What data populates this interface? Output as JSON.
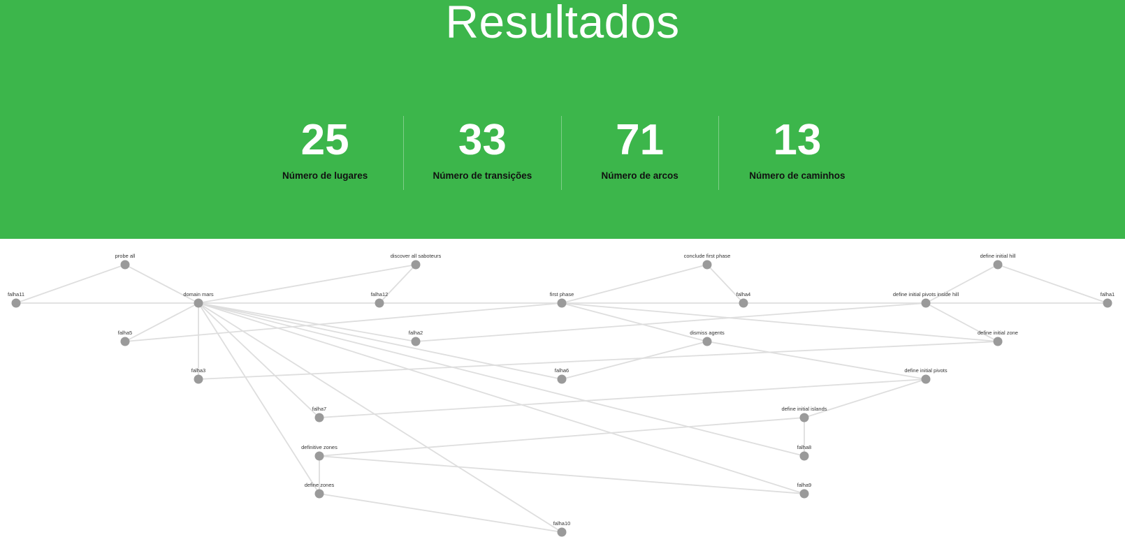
{
  "header": {
    "title": "Resultados"
  },
  "stats": [
    {
      "value": "25",
      "label": "Número de lugares"
    },
    {
      "value": "33",
      "label": "Número de transições"
    },
    {
      "value": "71",
      "label": "Número de arcos"
    },
    {
      "value": "13",
      "label": "Número de caminhos"
    }
  ],
  "colors": {
    "accent": "#3cb64b",
    "node": "#9a9a9a",
    "edge": "#dedede"
  },
  "graph": {
    "nodes": [
      {
        "id": "probe_all",
        "label": "probe all"
      },
      {
        "id": "discover_all_saboteurs",
        "label": "discover all saboteurs"
      },
      {
        "id": "conclude_first_phase",
        "label": "conclude first phase"
      },
      {
        "id": "define_initial_hill",
        "label": "define initial hill"
      },
      {
        "id": "falha11",
        "label": "falha11"
      },
      {
        "id": "domain_mars",
        "label": "domain mars"
      },
      {
        "id": "falha12",
        "label": "falha12"
      },
      {
        "id": "first_phase",
        "label": "first phase"
      },
      {
        "id": "falha4",
        "label": "falha4"
      },
      {
        "id": "define_initial_pivots_inside_hill",
        "label": "define initial pivots inside hill"
      },
      {
        "id": "falha1",
        "label": "falha1"
      },
      {
        "id": "falha5",
        "label": "falha5"
      },
      {
        "id": "falha2",
        "label": "falha2"
      },
      {
        "id": "dismiss_agents",
        "label": "dismiss agents"
      },
      {
        "id": "define_initial_zone",
        "label": "define initial zone"
      },
      {
        "id": "falha3",
        "label": "falha3"
      },
      {
        "id": "falha6",
        "label": "falha6"
      },
      {
        "id": "define_initial_pivots",
        "label": "define initial pivots"
      },
      {
        "id": "falha7",
        "label": "falha7"
      },
      {
        "id": "define_initial_islands",
        "label": "define initial islands"
      },
      {
        "id": "definitive_zones",
        "label": "definitive zones"
      },
      {
        "id": "falha8",
        "label": "falha8"
      },
      {
        "id": "define_zones",
        "label": "define zones"
      },
      {
        "id": "falha9",
        "label": "falha9"
      },
      {
        "id": "falha10",
        "label": "falha10"
      }
    ],
    "edges": [
      [
        "probe_all",
        "falha11"
      ],
      [
        "probe_all",
        "domain_mars"
      ],
      [
        "falha11",
        "domain_mars"
      ],
      [
        "discover_all_saboteurs",
        "domain_mars"
      ],
      [
        "discover_all_saboteurs",
        "falha12"
      ],
      [
        "domain_mars",
        "first_phase"
      ],
      [
        "domain_mars",
        "falha5"
      ],
      [
        "falha3",
        "domain_mars"
      ],
      [
        "domain_mars",
        "falha2"
      ],
      [
        "domain_mars",
        "falha6"
      ],
      [
        "domain_mars",
        "falha7"
      ],
      [
        "domain_mars",
        "define_zones"
      ],
      [
        "domain_mars",
        "falha8"
      ],
      [
        "domain_mars",
        "falha9"
      ],
      [
        "domain_mars",
        "falha10"
      ],
      [
        "first_phase",
        "falha5"
      ],
      [
        "first_phase",
        "conclude_first_phase"
      ],
      [
        "first_phase",
        "falha4"
      ],
      [
        "conclude_first_phase",
        "falha4"
      ],
      [
        "first_phase",
        "dismiss_agents"
      ],
      [
        "first_phase",
        "define_initial_zone"
      ],
      [
        "dismiss_agents",
        "falha6"
      ],
      [
        "dismiss_agents",
        "define_initial_pivots"
      ],
      [
        "define_initial_hill",
        "define_initial_pivots_inside_hill"
      ],
      [
        "define_initial_hill",
        "falha1"
      ],
      [
        "falha4",
        "falha1"
      ],
      [
        "define_initial_pivots_inside_hill",
        "falha2"
      ],
      [
        "define_initial_pivots_inside_hill",
        "define_initial_zone"
      ],
      [
        "define_initial_zone",
        "falha3"
      ],
      [
        "define_initial_pivots",
        "falha7"
      ],
      [
        "define_initial_pivots",
        "define_initial_islands"
      ],
      [
        "define_initial_islands",
        "definitive_zones"
      ],
      [
        "define_initial_islands",
        "falha8"
      ],
      [
        "definitive_zones",
        "define_zones"
      ],
      [
        "definitive_zones",
        "falha9"
      ],
      [
        "define_zones",
        "falha10"
      ]
    ]
  }
}
